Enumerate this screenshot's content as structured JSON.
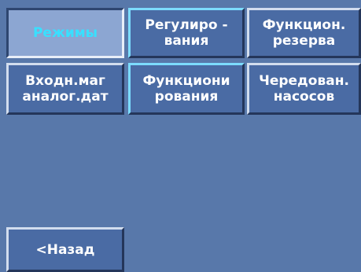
{
  "menu": {
    "buttons": [
      {
        "label": "Режимы",
        "selected": true
      },
      {
        "label": "Регулиро -\nвания",
        "selected": false
      },
      {
        "label": "Функцион.\nрезерва",
        "selected": false
      },
      {
        "label": "Входн.маг\nаналог.дат",
        "selected": false
      },
      {
        "label": "Функциони\nрования",
        "selected": false
      },
      {
        "label": "Чередован.\nнасосов",
        "selected": false
      }
    ]
  },
  "footer": {
    "back_label": "<Назад"
  },
  "colors": {
    "background": "#5878aa",
    "button": "#4a6ba4",
    "selected_button": "#8ca6d2",
    "selected_text": "#38e0ff",
    "text": "#ffffff"
  }
}
